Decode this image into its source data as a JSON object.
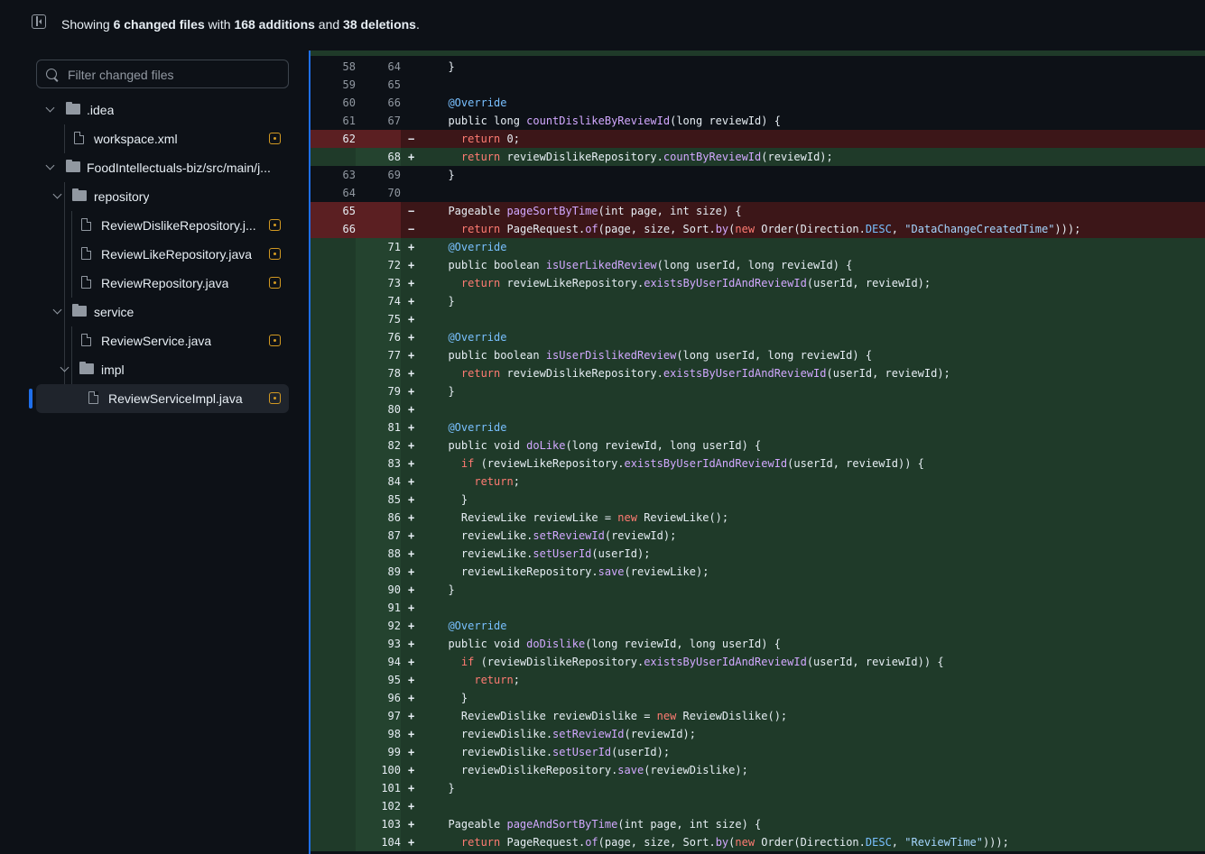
{
  "summary": {
    "prefix": "Showing ",
    "files": "6 changed files",
    "mid": " with ",
    "additions": "168 additions",
    "and": " and ",
    "deletions": "38 deletions",
    "suffix": "."
  },
  "filter": {
    "placeholder": "Filter changed files"
  },
  "tree": {
    "idea": ".idea",
    "workspace": "workspace.xml",
    "food": "FoodIntellectuals-biz/src/main/j...",
    "repository": "repository",
    "dislike_repo": "ReviewDislikeRepository.j...",
    "like_repo": "ReviewLikeRepository.java",
    "review_repo": "ReviewRepository.java",
    "service": "service",
    "review_service": "ReviewService.java",
    "impl": "impl",
    "review_service_impl": "ReviewServiceImpl.java"
  },
  "colors": {
    "accent": "#1f6feb",
    "modified": "#d29922",
    "addition_bg": "#1f3a29",
    "deletion_bg": "#3c1618"
  },
  "diff": [
    {
      "type": "ctx",
      "old": "58",
      "new": "64",
      "mark": "",
      "code": "  }"
    },
    {
      "type": "ctx",
      "old": "59",
      "new": "65",
      "mark": "",
      "code": ""
    },
    {
      "type": "ctx",
      "old": "60",
      "new": "66",
      "mark": "",
      "code": "  @Override"
    },
    {
      "type": "ctx",
      "old": "61",
      "new": "67",
      "mark": "",
      "code": "  public long countDislikeByReviewId(long reviewId) {"
    },
    {
      "type": "del",
      "old": "62",
      "new": "",
      "mark": "−",
      "code": "    return 0;"
    },
    {
      "type": "add",
      "old": "",
      "new": "68",
      "mark": "+",
      "code": "    return reviewDislikeRepository.countByReviewId(reviewId);"
    },
    {
      "type": "ctx",
      "old": "63",
      "new": "69",
      "mark": "",
      "code": "  }"
    },
    {
      "type": "ctx",
      "old": "64",
      "new": "70",
      "mark": "",
      "code": ""
    },
    {
      "type": "del",
      "old": "65",
      "new": "",
      "mark": "−",
      "code": "  Pageable pageSortByTime(int page, int size) {"
    },
    {
      "type": "del",
      "old": "66",
      "new": "",
      "mark": "−",
      "code": "    return PageRequest.of(page, size, Sort.by(new Order(Direction.DESC, \"DataChangeCreatedTime\")));"
    },
    {
      "type": "add",
      "old": "",
      "new": "71",
      "mark": "+",
      "code": "  @Override"
    },
    {
      "type": "add",
      "old": "",
      "new": "72",
      "mark": "+",
      "code": "  public boolean isUserLikedReview(long userId, long reviewId) {"
    },
    {
      "type": "add",
      "old": "",
      "new": "73",
      "mark": "+",
      "code": "    return reviewLikeRepository.existsByUserIdAndReviewId(userId, reviewId);"
    },
    {
      "type": "add",
      "old": "",
      "new": "74",
      "mark": "+",
      "code": "  }"
    },
    {
      "type": "add",
      "old": "",
      "new": "75",
      "mark": "+",
      "code": ""
    },
    {
      "type": "add",
      "old": "",
      "new": "76",
      "mark": "+",
      "code": "  @Override"
    },
    {
      "type": "add",
      "old": "",
      "new": "77",
      "mark": "+",
      "code": "  public boolean isUserDislikedReview(long userId, long reviewId) {"
    },
    {
      "type": "add",
      "old": "",
      "new": "78",
      "mark": "+",
      "code": "    return reviewDislikeRepository.existsByUserIdAndReviewId(userId, reviewId);"
    },
    {
      "type": "add",
      "old": "",
      "new": "79",
      "mark": "+",
      "code": "  }"
    },
    {
      "type": "add",
      "old": "",
      "new": "80",
      "mark": "+",
      "code": ""
    },
    {
      "type": "add",
      "old": "",
      "new": "81",
      "mark": "+",
      "code": "  @Override"
    },
    {
      "type": "add",
      "old": "",
      "new": "82",
      "mark": "+",
      "code": "  public void doLike(long reviewId, long userId) {"
    },
    {
      "type": "add",
      "old": "",
      "new": "83",
      "mark": "+",
      "code": "    if (reviewLikeRepository.existsByUserIdAndReviewId(userId, reviewId)) {"
    },
    {
      "type": "add",
      "old": "",
      "new": "84",
      "mark": "+",
      "code": "      return;"
    },
    {
      "type": "add",
      "old": "",
      "new": "85",
      "mark": "+",
      "code": "    }"
    },
    {
      "type": "add",
      "old": "",
      "new": "86",
      "mark": "+",
      "code": "    ReviewLike reviewLike = new ReviewLike();"
    },
    {
      "type": "add",
      "old": "",
      "new": "87",
      "mark": "+",
      "code": "    reviewLike.setReviewId(reviewId);"
    },
    {
      "type": "add",
      "old": "",
      "new": "88",
      "mark": "+",
      "code": "    reviewLike.setUserId(userId);"
    },
    {
      "type": "add",
      "old": "",
      "new": "89",
      "mark": "+",
      "code": "    reviewLikeRepository.save(reviewLike);"
    },
    {
      "type": "add",
      "old": "",
      "new": "90",
      "mark": "+",
      "code": "  }"
    },
    {
      "type": "add",
      "old": "",
      "new": "91",
      "mark": "+",
      "code": ""
    },
    {
      "type": "add",
      "old": "",
      "new": "92",
      "mark": "+",
      "code": "  @Override"
    },
    {
      "type": "add",
      "old": "",
      "new": "93",
      "mark": "+",
      "code": "  public void doDislike(long reviewId, long userId) {"
    },
    {
      "type": "add",
      "old": "",
      "new": "94",
      "mark": "+",
      "code": "    if (reviewDislikeRepository.existsByUserIdAndReviewId(userId, reviewId)) {"
    },
    {
      "type": "add",
      "old": "",
      "new": "95",
      "mark": "+",
      "code": "      return;"
    },
    {
      "type": "add",
      "old": "",
      "new": "96",
      "mark": "+",
      "code": "    }"
    },
    {
      "type": "add",
      "old": "",
      "new": "97",
      "mark": "+",
      "code": "    ReviewDislike reviewDislike = new ReviewDislike();"
    },
    {
      "type": "add",
      "old": "",
      "new": "98",
      "mark": "+",
      "code": "    reviewDislike.setReviewId(reviewId);"
    },
    {
      "type": "add",
      "old": "",
      "new": "99",
      "mark": "+",
      "code": "    reviewDislike.setUserId(userId);"
    },
    {
      "type": "add",
      "old": "",
      "new": "100",
      "mark": "+",
      "code": "    reviewDislikeRepository.save(reviewDislike);"
    },
    {
      "type": "add",
      "old": "",
      "new": "101",
      "mark": "+",
      "code": "  }"
    },
    {
      "type": "add",
      "old": "",
      "new": "102",
      "mark": "+",
      "code": ""
    },
    {
      "type": "add",
      "old": "",
      "new": "103",
      "mark": "+",
      "code": "  Pageable pageAndSortByTime(int page, int size) {"
    },
    {
      "type": "add",
      "old": "",
      "new": "104",
      "mark": "+",
      "code": "    return PageRequest.of(page, size, Sort.by(new Order(Direction.DESC, \"ReviewTime\")));"
    }
  ]
}
